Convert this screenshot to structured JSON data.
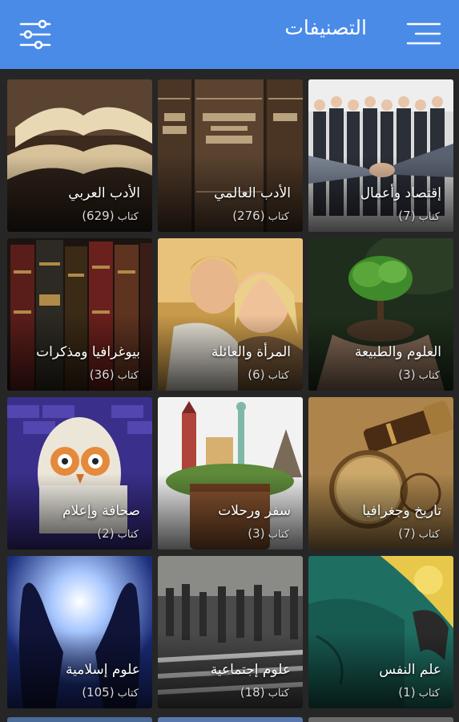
{
  "app_bar": {
    "title": "التصنيفات",
    "color": "#4a8be8",
    "left_icon": "filter-sliders-icon",
    "right_icon": "hamburger-menu-icon"
  },
  "categories": [
    {
      "name": "إقتصاد وأعمال",
      "count": "(7)",
      "unit": "كتاب"
    },
    {
      "name": "الأدب العالمي",
      "count": "(276)",
      "unit": "كتاب"
    },
    {
      "name": "الأدب العربي",
      "count": "(629)",
      "unit": "كتاب"
    },
    {
      "name": "العلوم والطبيعة",
      "count": "(3)",
      "unit": "كتاب"
    },
    {
      "name": "المرأة والعائلة",
      "count": "(6)",
      "unit": "كتاب"
    },
    {
      "name": "بيوغرافيا ومذكرات",
      "count": "(36)",
      "unit": "كتاب"
    },
    {
      "name": "تاريخ وجغرافيا",
      "count": "(7)",
      "unit": "كتاب"
    },
    {
      "name": "سفر ورحلات",
      "count": "(3)",
      "unit": "كتاب"
    },
    {
      "name": "صحافة وإعلام",
      "count": "(2)",
      "unit": "كتاب"
    },
    {
      "name": "علم النفس",
      "count": "(1)",
      "unit": "كتاب"
    },
    {
      "name": "علوم إجتماعية",
      "count": "(18)",
      "unit": "كتاب"
    },
    {
      "name": "علوم إسلامية",
      "count": "(105)",
      "unit": "كتاب"
    }
  ]
}
